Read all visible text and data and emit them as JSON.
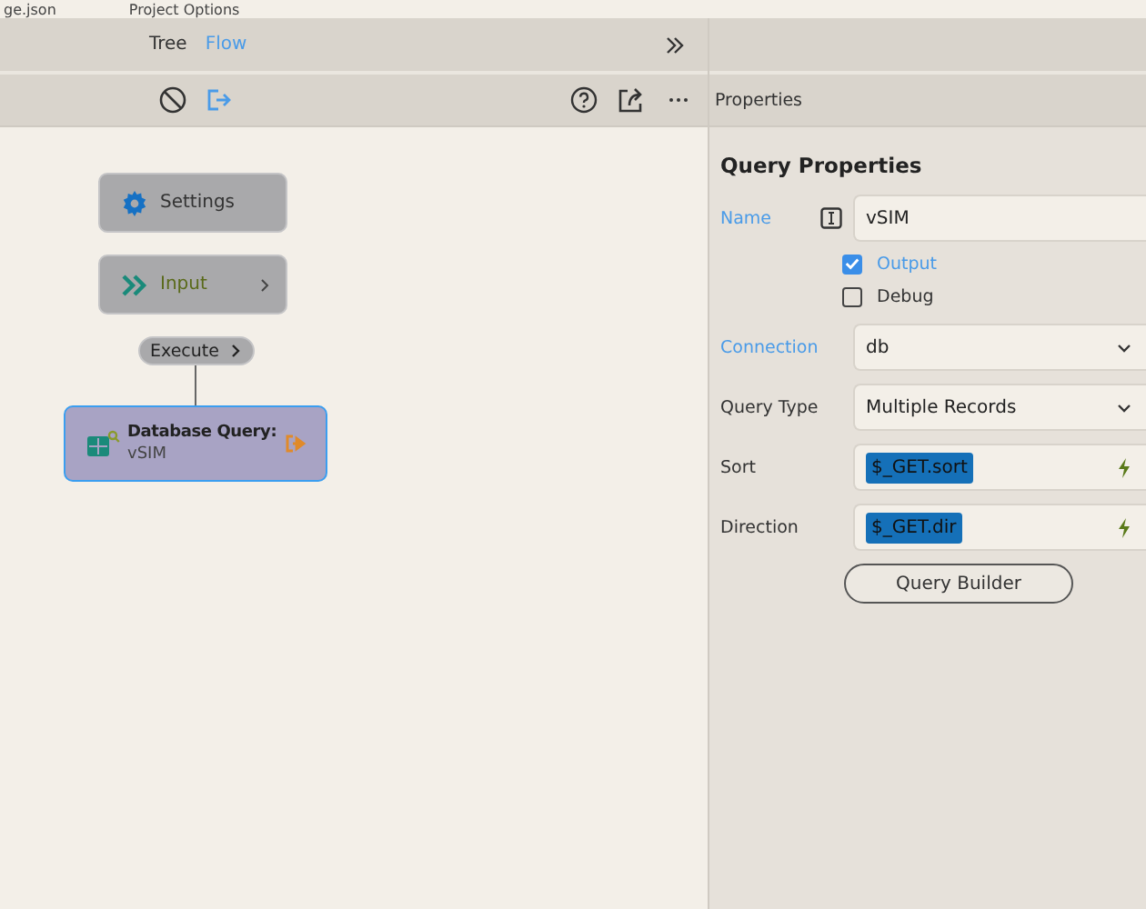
{
  "top_strip": {
    "file_tab": "ge.json",
    "menu_item": "Project Options"
  },
  "tabs": [
    {
      "label": "Tree",
      "selected": false
    },
    {
      "label": "Flow",
      "selected": true
    }
  ],
  "panel_title": "Properties",
  "nodes": [
    {
      "kind": "settings",
      "title": "Settings",
      "selected": false
    },
    {
      "kind": "input",
      "title": "Input",
      "selected": false
    },
    {
      "kind": "pill",
      "title": "Execute",
      "selected": false
    },
    {
      "kind": "query",
      "title": "Database Query:",
      "subtitle": "vSIM",
      "selected": true
    }
  ],
  "properties": {
    "heading": "Query Properties",
    "fields": [
      {
        "kind": "text",
        "label": "Name",
        "highlighted": true,
        "value": "vSIM"
      },
      {
        "kind": "checkbox",
        "label": "Output",
        "checked": true
      },
      {
        "kind": "checkbox",
        "label": "Debug",
        "checked": false
      },
      {
        "kind": "select",
        "label": "Connection",
        "highlighted": true,
        "value": "db"
      },
      {
        "kind": "select",
        "label": "Query Type",
        "highlighted": false,
        "value": "Multiple Records"
      },
      {
        "kind": "binding",
        "label": "Sort",
        "highlighted": false,
        "value": "$_GET.sort"
      },
      {
        "kind": "binding",
        "label": "Direction",
        "highlighted": false,
        "value": "$_GET.dir"
      }
    ],
    "button": "Query Builder"
  }
}
